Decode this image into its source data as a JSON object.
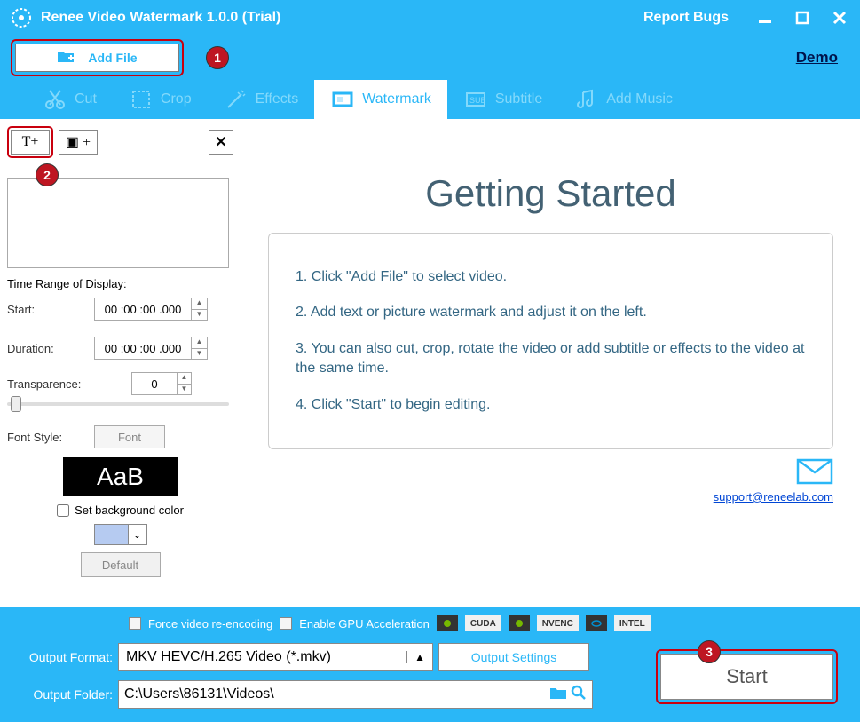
{
  "title": "Renee Video Watermark 1.0.0 (Trial)",
  "report_bugs": "Report Bugs",
  "demo": "Demo",
  "add_file": "Add File",
  "badges": {
    "b1": "1",
    "b2": "2",
    "b3": "3"
  },
  "tabs": {
    "cut": "Cut",
    "crop": "Crop",
    "effects": "Effects",
    "watermark": "Watermark",
    "subtitle": "Subtitle",
    "addmusic": "Add Music"
  },
  "left": {
    "text_add": "T+",
    "pic_add": "▣ +",
    "close": "✕",
    "time_range": "Time Range of Display:",
    "start_label": "Start:",
    "start_value": "00 :00 :00 .000",
    "duration_label": "Duration:",
    "duration_value": "00 :00 :00 .000",
    "transparence_label": "Transparence:",
    "transparence_value": "0",
    "font_style_label": "Font Style:",
    "font_btn": "Font",
    "font_preview": "AaB",
    "bg_color_chk": "Set background color",
    "default_btn": "Default"
  },
  "getting_started": {
    "title": "Getting Started",
    "s1": "1. Click \"Add File\" to select video.",
    "s2": "2. Add text or picture watermark and adjust it on the left.",
    "s3": "3. You can also cut, crop, rotate the video or add subtitle or effects to the video at the same time.",
    "s4": "4. Click \"Start\" to begin editing."
  },
  "support_email": "support@reneelab.com",
  "bottom": {
    "force_reencode": "Force video re-encoding",
    "gpu_accel": "Enable GPU Acceleration",
    "cuda": "CUDA",
    "nvenc": "NVENC",
    "intel": "INTEL",
    "output_format_label": "Output Format:",
    "output_format_value": "MKV HEVC/H.265 Video (*.mkv)",
    "output_settings": "Output Settings",
    "output_folder_label": "Output Folder:",
    "output_folder_value": "C:\\Users\\86131\\Videos\\",
    "start": "Start"
  }
}
